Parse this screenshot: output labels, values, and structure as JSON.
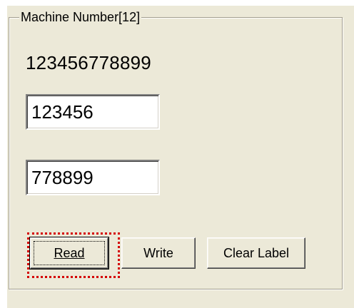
{
  "machine_number": {
    "group_title": "Machine Number[12]",
    "display_value": "123456778899",
    "field_1_value": "123456",
    "field_2_value": "778899"
  },
  "buttons": {
    "read_label": "Read",
    "write_label": "Write",
    "clear_label": "Clear Label"
  },
  "colors": {
    "panel_background": "#ece9d8",
    "highlight_border": "#d40000",
    "field_background": "#ffffff",
    "text": "#000000"
  }
}
